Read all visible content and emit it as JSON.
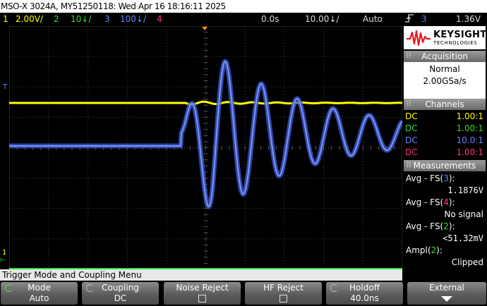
{
  "title": "MSO-X 3024A, MY51250118: Wed Apr 16 18:16:11 2025",
  "status_bar": {
    "ch1": {
      "num": "1",
      "scale": "2.00V/",
      "color": "#ffff00"
    },
    "ch2": {
      "num": "2",
      "scale": "10↓/",
      "color": "#33dd33"
    },
    "ch3": {
      "num": "3",
      "scale": "100↓/",
      "color": "#6688ff"
    },
    "ch4": {
      "num": "4",
      "color": "#ff3388"
    },
    "delay": "0.0s",
    "timebase": "10.00↓/",
    "trigger_mode": "Auto",
    "trigger_slope_icon": "rising-edge-icon",
    "trigger_source": "3",
    "trigger_level": "1.36V"
  },
  "brand": {
    "name": "KEYSIGHT",
    "sub": "TECHNOLOGIES",
    "logo_color": "#e31b23"
  },
  "acquisition": {
    "header": "Acquisition",
    "mode": "Normal",
    "rate": "2.00GSa/s"
  },
  "channels": {
    "header": "Channels",
    "rows": [
      {
        "coupling": "DC",
        "probe": "1.00:1",
        "color": "#ffff00"
      },
      {
        "coupling": "DC",
        "probe": "1.00:1",
        "color": "#33dd33"
      },
      {
        "coupling": "DC",
        "probe": "10.0:1",
        "color": "#6688ff"
      },
      {
        "coupling": "DC",
        "probe": "1.00:1",
        "color": "#ff3388"
      }
    ]
  },
  "measurements": {
    "header": "Measurements",
    "items": [
      {
        "label": "Avg - FS(",
        "ch": "3",
        "ch_color": "#6688ff",
        "value": "1.1876V"
      },
      {
        "label": "Avg - FS(",
        "ch": "4",
        "ch_color": "#ff3388",
        "value": "No signal"
      },
      {
        "label": "Avg - FS(",
        "ch": "2",
        "ch_color": "#33dd33",
        "value": "<51.32mV"
      },
      {
        "label": "Ampl(",
        "ch": "2",
        "ch_color": "#33dd33",
        "value": "Clipped"
      }
    ]
  },
  "trigger_menu_caption": "Trigger Mode and Coupling Menu",
  "softkeys": [
    {
      "label": "Mode",
      "value": "Auto"
    },
    {
      "label": "Coupling",
      "value": "DC"
    },
    {
      "label": "Noise Reject",
      "value": ""
    },
    {
      "label": "HF Reject",
      "value": ""
    },
    {
      "label": "Holdoff",
      "value": "40.0ns"
    },
    {
      "label": "External",
      "value": ""
    }
  ],
  "markers": {
    "trigger_level": "T",
    "ground": "1"
  }
}
